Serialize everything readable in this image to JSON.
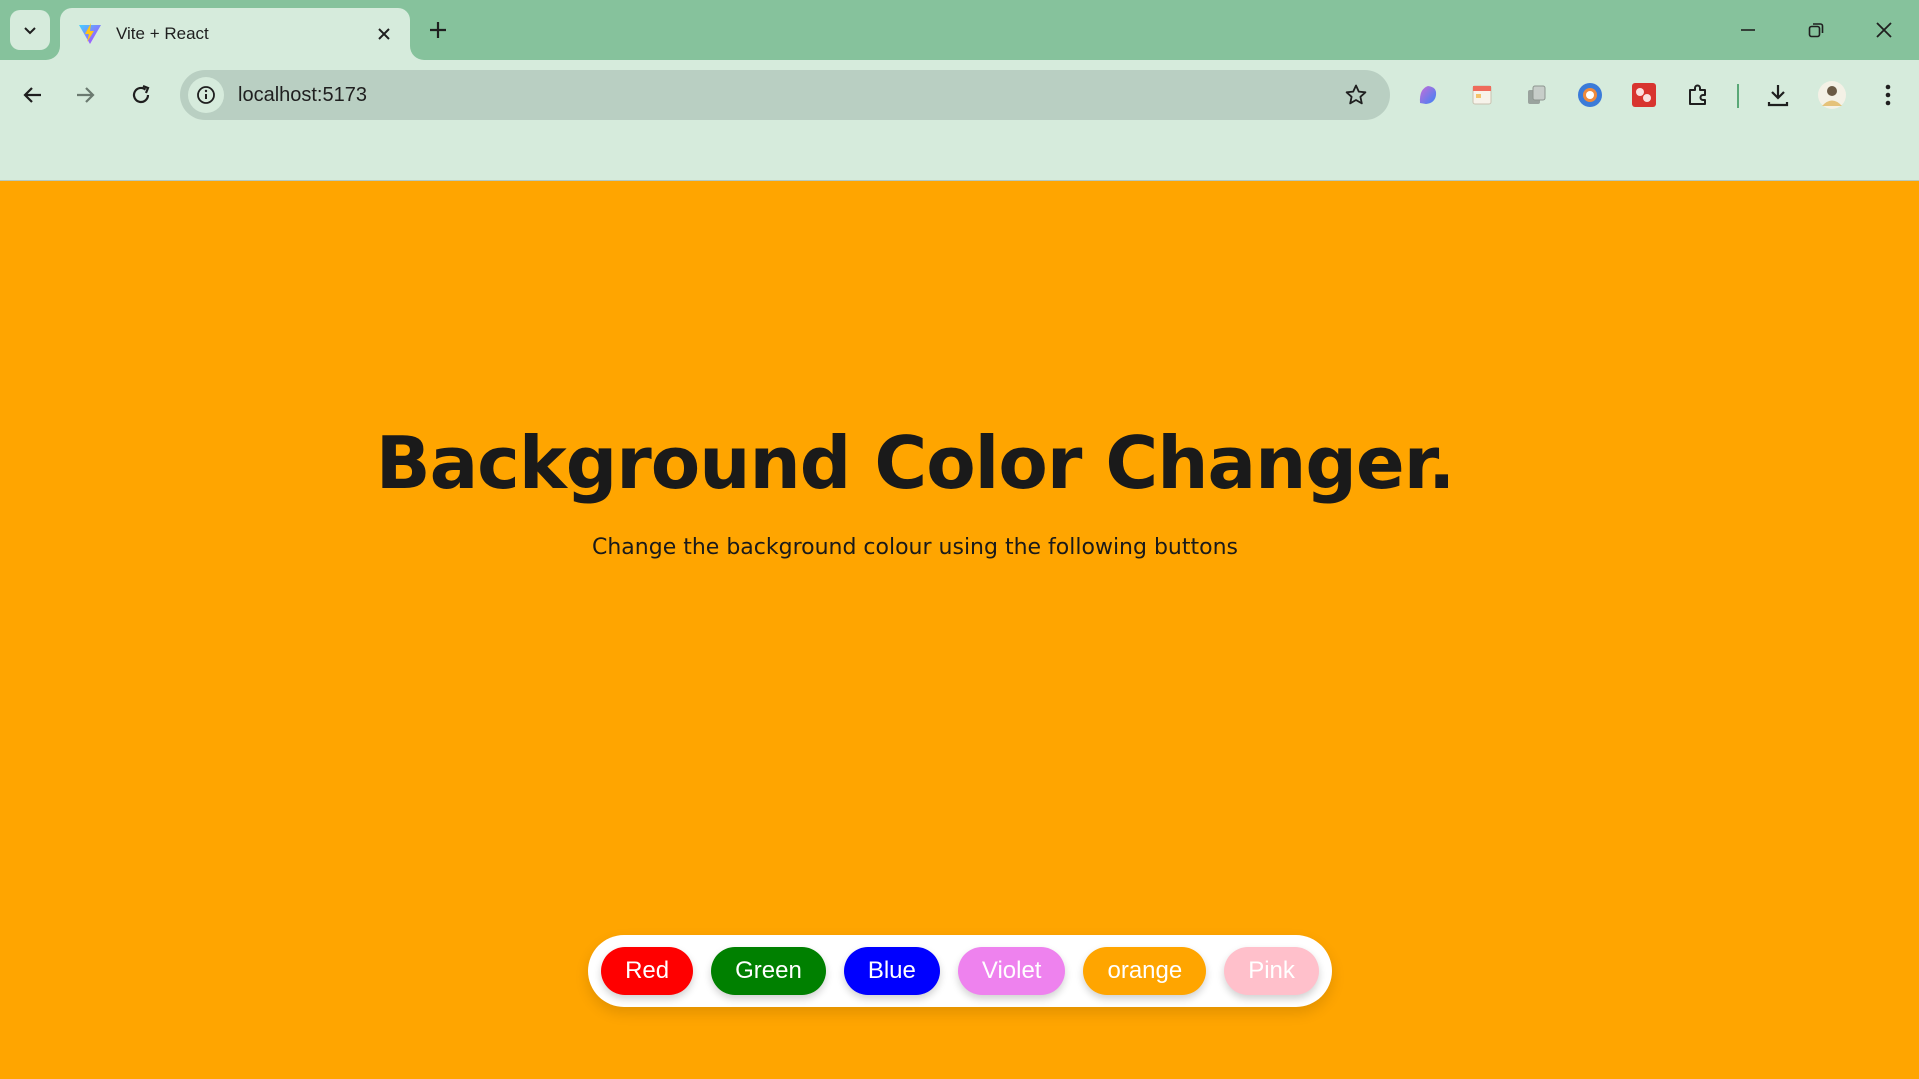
{
  "browser": {
    "tab_title": "Vite + React",
    "url": "localhost:5173",
    "colors": {
      "tabstrip": "#86c29c",
      "toolbar": "#d6ebdc",
      "omnibox": "#b9cfc2"
    },
    "extensions": [
      "copilot-icon",
      "calendar-ext-icon",
      "copy-ext-icon",
      "chrome-ext-icon",
      "puzzle-ext-red-icon",
      "extensions-puzzle-icon"
    ],
    "toolbar_icons": [
      "download-icon",
      "profile-avatar",
      "menu-dots-icon"
    ]
  },
  "page": {
    "background": "#ffa500",
    "title": "Background Color Changer.",
    "subtitle": "Change the background colour using the following buttons",
    "buttons": [
      {
        "label": "Red",
        "color": "#ff0000"
      },
      {
        "label": "Green",
        "color": "#008000"
      },
      {
        "label": "Blue",
        "color": "#0000ff"
      },
      {
        "label": "Violet",
        "color": "#ee82ee"
      },
      {
        "label": "orange",
        "color": "#ffa500"
      },
      {
        "label": "Pink",
        "color": "#ffc0cb"
      }
    ]
  }
}
